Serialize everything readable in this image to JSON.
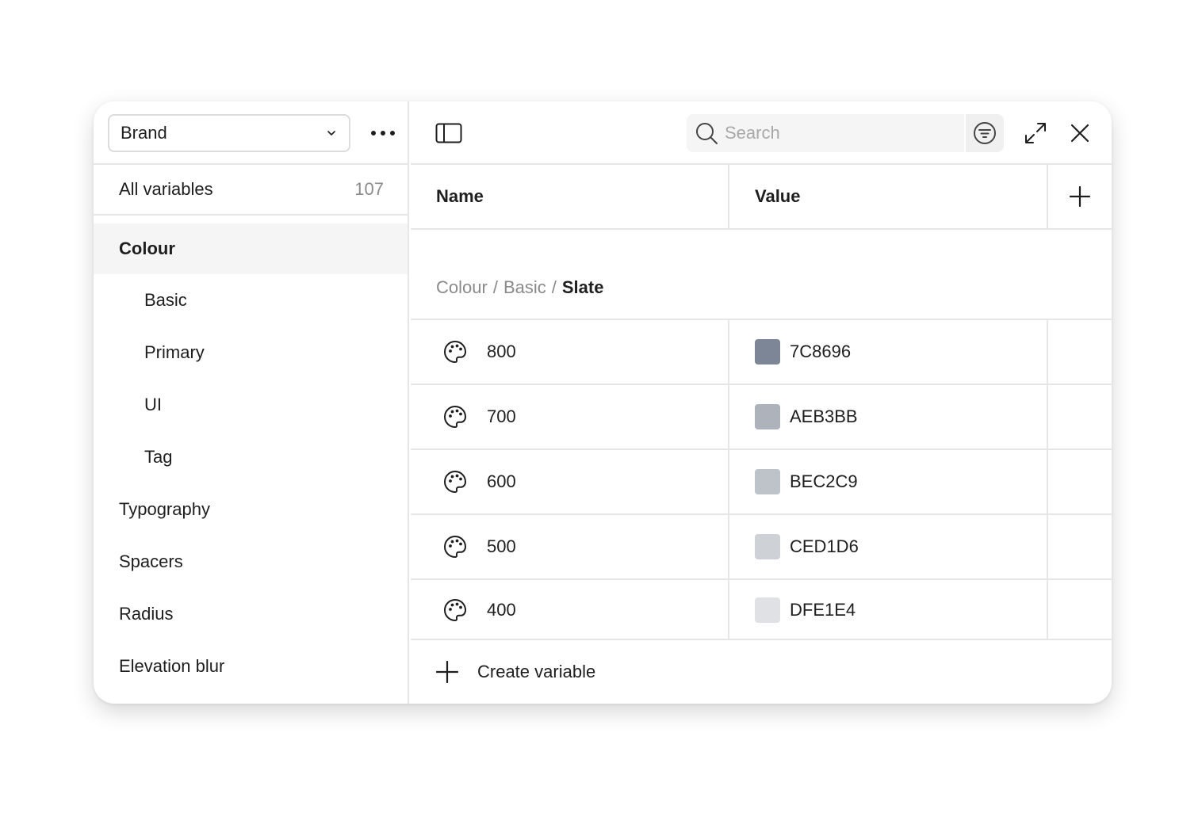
{
  "sidebar": {
    "collection": "Brand",
    "all_variables_label": "All variables",
    "all_variables_count": "107",
    "groups": [
      {
        "label": "Colour"
      },
      {
        "label": "Basic"
      },
      {
        "label": "Primary"
      },
      {
        "label": "UI"
      },
      {
        "label": "Tag"
      },
      {
        "label": "Typography"
      },
      {
        "label": "Spacers"
      },
      {
        "label": "Radius"
      },
      {
        "label": "Elevation blur"
      }
    ]
  },
  "toolbar": {
    "search_placeholder": "Search"
  },
  "table": {
    "col_name": "Name",
    "col_value": "Value"
  },
  "breadcrumb": {
    "parts": [
      "Colour",
      "Basic"
    ],
    "separator": "/",
    "current": "Slate"
  },
  "rows": [
    {
      "name": "800",
      "hex": "7C8696",
      "color": "#7C8696"
    },
    {
      "name": "700",
      "hex": "AEB3BB",
      "color": "#AEB3BB"
    },
    {
      "name": "600",
      "hex": "BEC2C9",
      "color": "#BEC2C9"
    },
    {
      "name": "500",
      "hex": "CED1D6",
      "color": "#CED1D6"
    },
    {
      "name": "400",
      "hex": "DFE1E4",
      "color": "#DFE1E4"
    }
  ],
  "create_label": "Create variable",
  "icons": {
    "chevron": "chevron-down-icon",
    "more": "more-horizontal-icon",
    "sidebar_toggle": "sidebar-toggle-icon",
    "search": "search-icon",
    "filter": "filter-icon",
    "expand": "expand-icon",
    "close": "close-icon",
    "add": "plus-icon",
    "palette": "palette-icon"
  }
}
